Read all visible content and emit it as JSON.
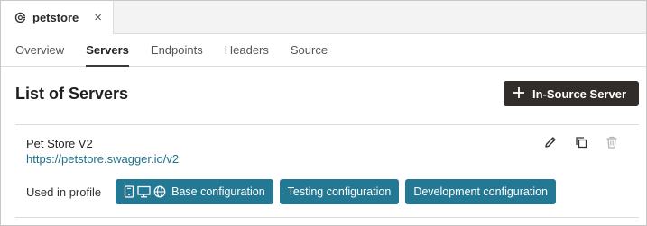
{
  "editor_tab": {
    "icon": "api-icon",
    "label": "petstore",
    "close_glyph": "×"
  },
  "subtabs": [
    {
      "label": "Overview",
      "active": false
    },
    {
      "label": "Servers",
      "active": true
    },
    {
      "label": "Endpoints",
      "active": false
    },
    {
      "label": "Headers",
      "active": false
    },
    {
      "label": "Source",
      "active": false
    }
  ],
  "page": {
    "title": "List of Servers",
    "add_button": {
      "icon": "plus-icon",
      "label": "In-Source Server"
    }
  },
  "server": {
    "name": "Pet Store V2",
    "url": "https://petstore.swagger.io/v2",
    "actions": [
      "edit-icon",
      "duplicate-icon",
      "delete-icon"
    ],
    "profile_label": "Used in profile",
    "profiles": [
      {
        "label": "Base configuration",
        "icons": [
          "mobile-icon",
          "desktop-icon",
          "globe-icon"
        ]
      },
      {
        "label": "Testing configuration"
      },
      {
        "label": "Development configuration"
      }
    ]
  },
  "colors": {
    "primary_button": "#312d2a",
    "chip": "#237893",
    "link": "#20708a"
  }
}
